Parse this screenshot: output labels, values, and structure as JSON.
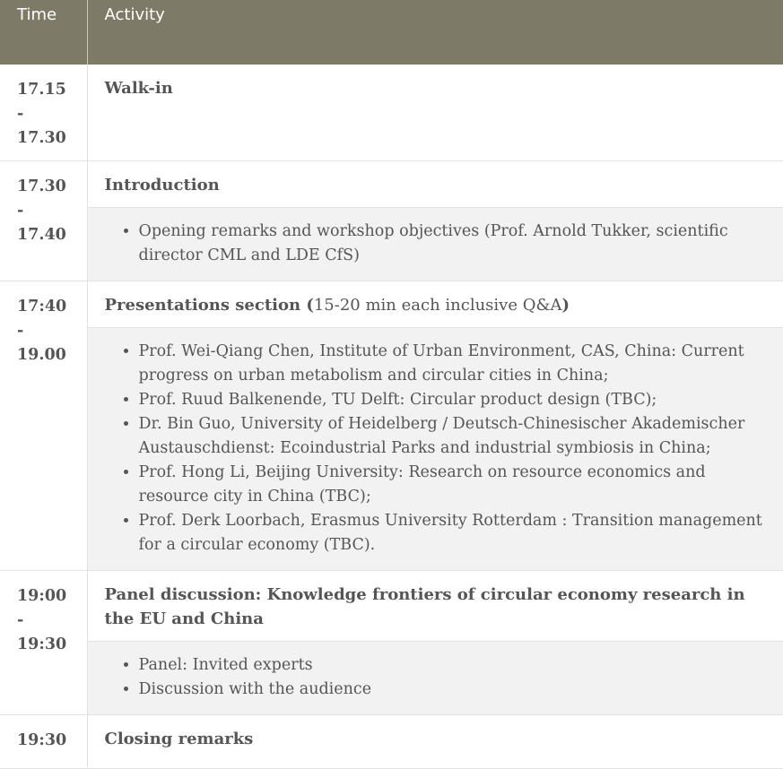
{
  "header": {
    "time": "Time",
    "activity": "Activity"
  },
  "rows": [
    {
      "time": [
        "17.15",
        "-",
        "17.30"
      ],
      "title": "Walk-in"
    },
    {
      "time": [
        "17.30",
        "-",
        "17.40"
      ],
      "title": "Introduction",
      "items": [
        "Opening remarks and workshop objectives (Prof. Arnold Tukker, scientific director CML and LDE CfS)"
      ]
    },
    {
      "time": [
        "17:40",
        "-",
        "19.00"
      ],
      "title": "Presentations section",
      "title_open": " (",
      "title_note": "15-20 min each  inclusive Q&A",
      "title_close": ")",
      "items": [
        "Prof. Wei-Qiang Chen, Institute of Urban Environment, CAS, China: Current progress on urban metabolism and circular cities  in China;",
        "Prof. Ruud Balkenende, TU Delft: Circular product design (TBC);",
        "Dr. Bin Guo, University of Heidelberg / Deutsch-Chinesischer Akademischer Austauschdienst: Ecoindustrial Parks and industrial symbiosis in China;",
        "Prof. Hong Li, Beijing University: Research on resource economics and resource city in China (TBC);",
        "Prof. Derk Loorbach, Erasmus University Rotterdam : Transition management for a circular economy (TBC)."
      ]
    },
    {
      "time": [
        "19:00",
        "-",
        "19:30"
      ],
      "title": "Panel discussion: Knowledge frontiers of circular economy research in the EU and China",
      "items": [
        "Panel: Invited experts",
        "Discussion with the audience"
      ]
    },
    {
      "time": [
        "19:30"
      ],
      "title": "Closing remarks"
    }
  ]
}
